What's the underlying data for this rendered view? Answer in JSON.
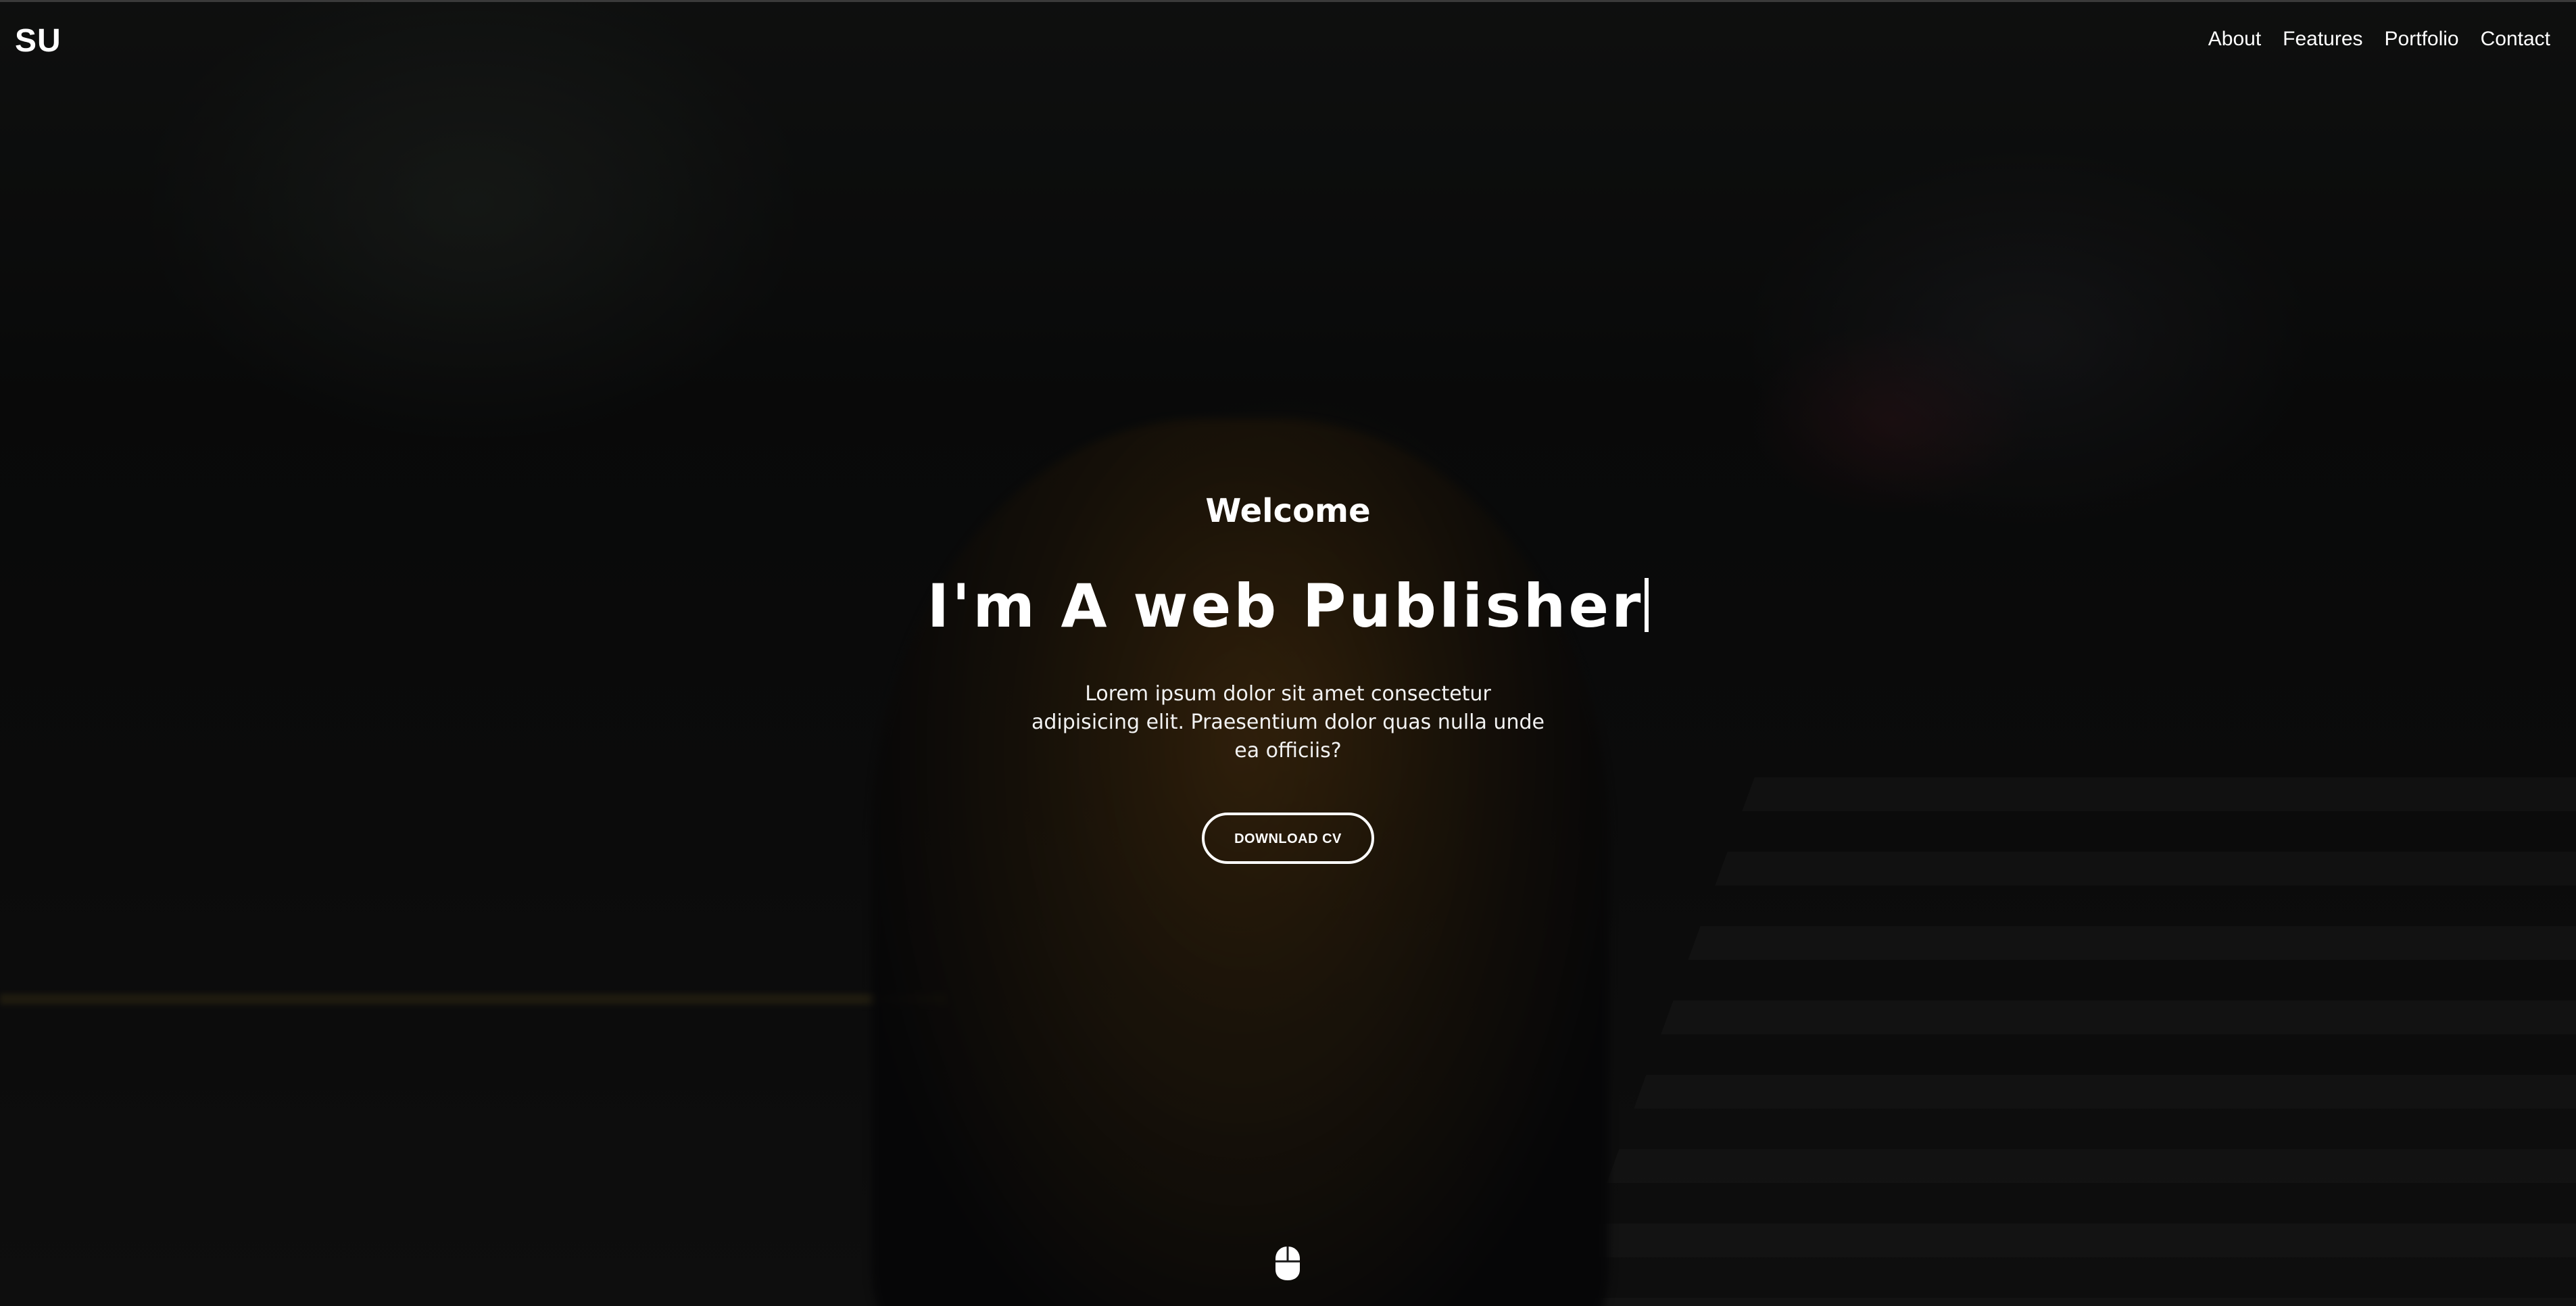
{
  "navbar": {
    "brand": "SU",
    "links": [
      {
        "label": "About"
      },
      {
        "label": "Features"
      },
      {
        "label": "Portfolio"
      },
      {
        "label": "Contact"
      }
    ]
  },
  "hero": {
    "welcome": "Welcome",
    "headline": "I'm A web Publisher",
    "description": "Lorem ipsum dolor sit amet consectetur adipisicing elit. Praesentium dolor quas nulla unde ea officiis?",
    "cta_label": "DOWNLOAD CV",
    "scroll_icon": "mouse-icon"
  },
  "colors": {
    "text": "#ffffff",
    "overlay": "rgba(0,0,0,0.45)",
    "accent_hair": "#7a4f1a"
  }
}
